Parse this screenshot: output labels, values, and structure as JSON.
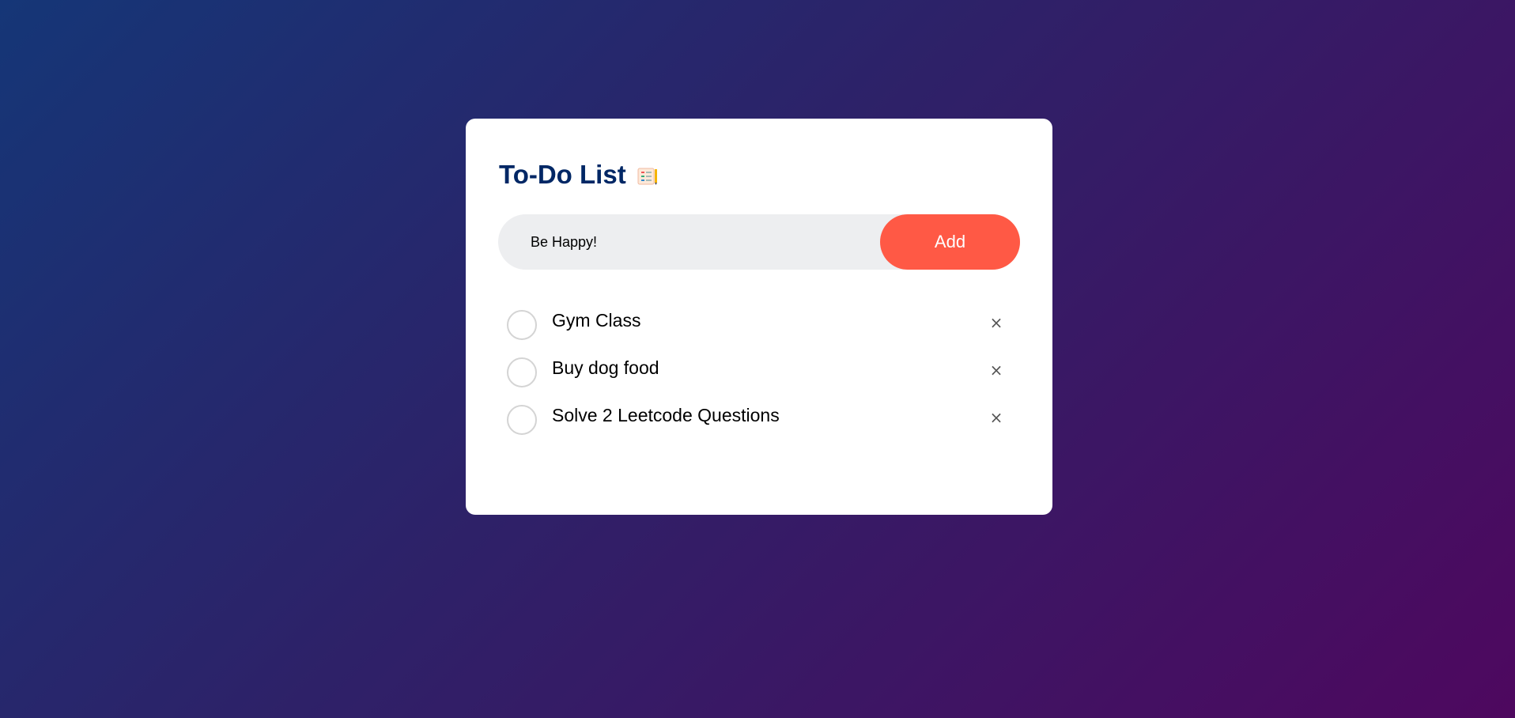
{
  "app": {
    "title": "To-Do List",
    "title_icon": "notepad-icon"
  },
  "input": {
    "value": "Be Happy!",
    "placeholder": ""
  },
  "add_button": {
    "label": "Add"
  },
  "tasks": [
    {
      "text": "Gym Class",
      "checked": false
    },
    {
      "text": "Buy dog food",
      "checked": false
    },
    {
      "text": "Solve 2 Leetcode Questions",
      "checked": false
    }
  ],
  "delete_glyph": "×",
  "colors": {
    "accent": "#ff5945",
    "title": "#002765",
    "background_start": "#153677",
    "background_end": "#4e085f"
  }
}
